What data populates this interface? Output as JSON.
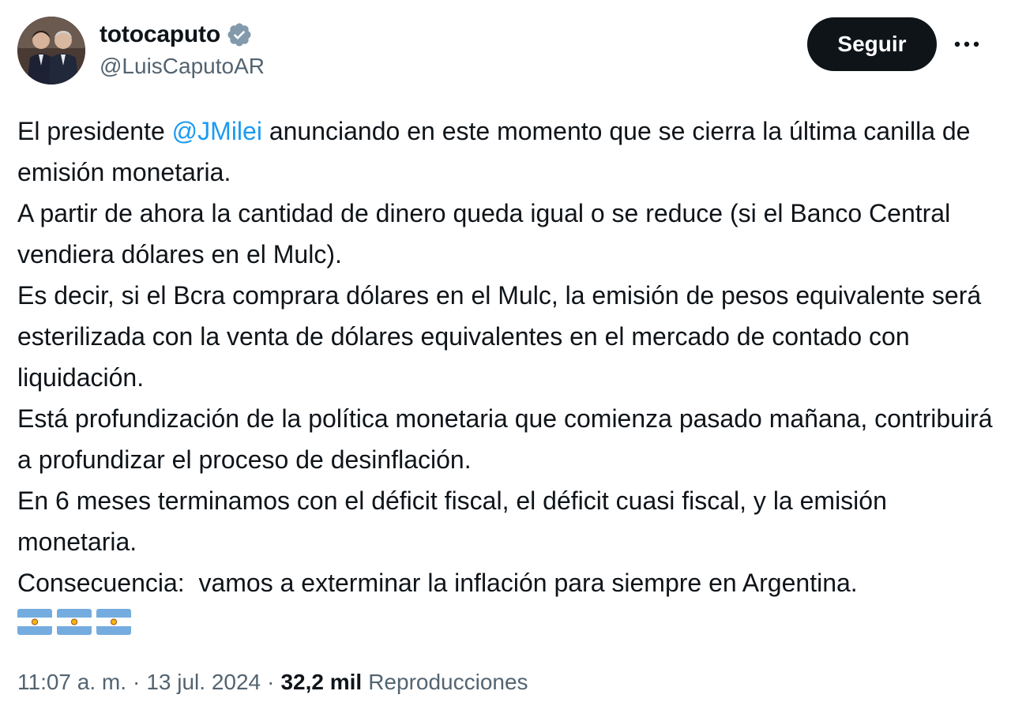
{
  "author": {
    "display_name": "totocaputo",
    "handle": "@LuisCaputoAR",
    "verified_icon": "verified-badge-icon"
  },
  "actions": {
    "follow_label": "Seguir",
    "more_icon": "more-horizontal-icon"
  },
  "tweet": {
    "paragraphs": [
      {
        "before": "El presidente ",
        "mention": "@JMilei",
        "after": " anunciando en este momento que se cierra la última canilla de emisión monetaria."
      },
      {
        "text": "A partir de ahora la cantidad de dinero queda igual o se reduce (si el Banco Central vendiera dólares en el Mulc)."
      },
      {
        "text": "Es decir, si el Bcra comprara dólares en el Mulc, la emisión de pesos equivalente será esterilizada con la venta de dólares equivalentes en el mercado de contado con liquidación."
      },
      {
        "text": "Está profundización de la política monetaria que comienza pasado mañana, contribuirá a profundizar el proceso de desinflación."
      },
      {
        "text": "En 6 meses terminamos con el déficit fiscal, el déficit cuasi fiscal, y la emisión monetaria."
      },
      {
        "text": "Consecuencia:  vamos a exterminar la inflación para siempre en Argentina."
      }
    ],
    "flags": [
      "argentina-flag-icon",
      "argentina-flag-icon",
      "argentina-flag-icon"
    ]
  },
  "meta": {
    "time": "11:07 a. m.",
    "separator": "·",
    "date": "13 jul. 2024",
    "views_count": "32,2 mil",
    "views_label": "Reproducciones"
  },
  "colors": {
    "text": "#0f1419",
    "secondary": "#536471",
    "link": "#1d9bf0",
    "verified": "#829aab",
    "button_bg": "#0f1419",
    "flag_blue": "#74acdf",
    "sun": "#f6b40e"
  }
}
